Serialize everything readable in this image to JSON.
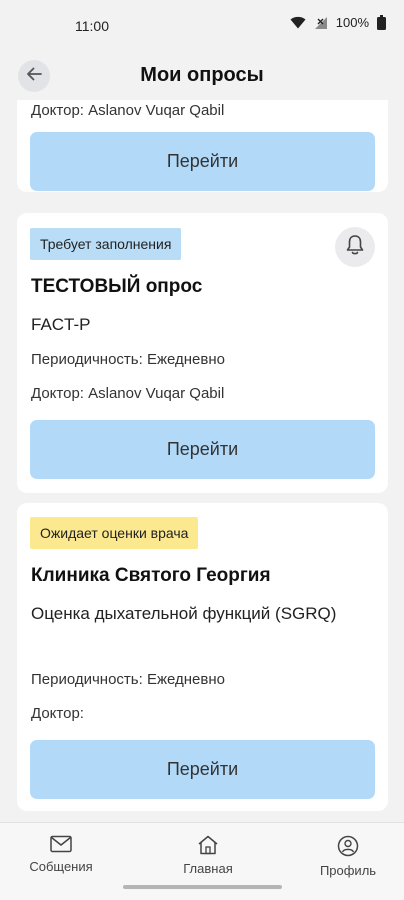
{
  "status_bar": {
    "time": "11:00",
    "battery": "100%"
  },
  "header": {
    "title": "Мои опросы",
    "back_icon": "arrow-left-icon"
  },
  "cards": [
    {
      "doctor": "Доктор: Aslanov Vuqar Qabil",
      "button_label": "Перейти"
    },
    {
      "status": "Требует заполнения",
      "status_color": "#b9dcf7",
      "title": "ТЕСТОВЫЙ опрос",
      "survey": "FACT-P",
      "periodicity": "Периодичность: Ежедневно",
      "doctor": "Доктор: Aslanov Vuqar Qabil",
      "button_label": "Перейти",
      "action_icon": "bell-icon"
    },
    {
      "status": "Ожидает оценки врача",
      "status_color": "#fbe88f",
      "title": "Клиника Святого Георгия",
      "survey": "Оценка дыхательной функций (SGRQ)",
      "periodicity": "Периодичность: Ежедневно",
      "doctor": "Доктор:",
      "button_label": "Перейти"
    }
  ],
  "bottom_nav": [
    {
      "label": "Собщения",
      "icon": "mail-icon"
    },
    {
      "label": "Главная",
      "icon": "home-icon"
    },
    {
      "label": "Профиль",
      "icon": "profile-icon"
    }
  ],
  "colors": {
    "accent_button": "#b2daf8",
    "background": "#f2f2f3"
  }
}
